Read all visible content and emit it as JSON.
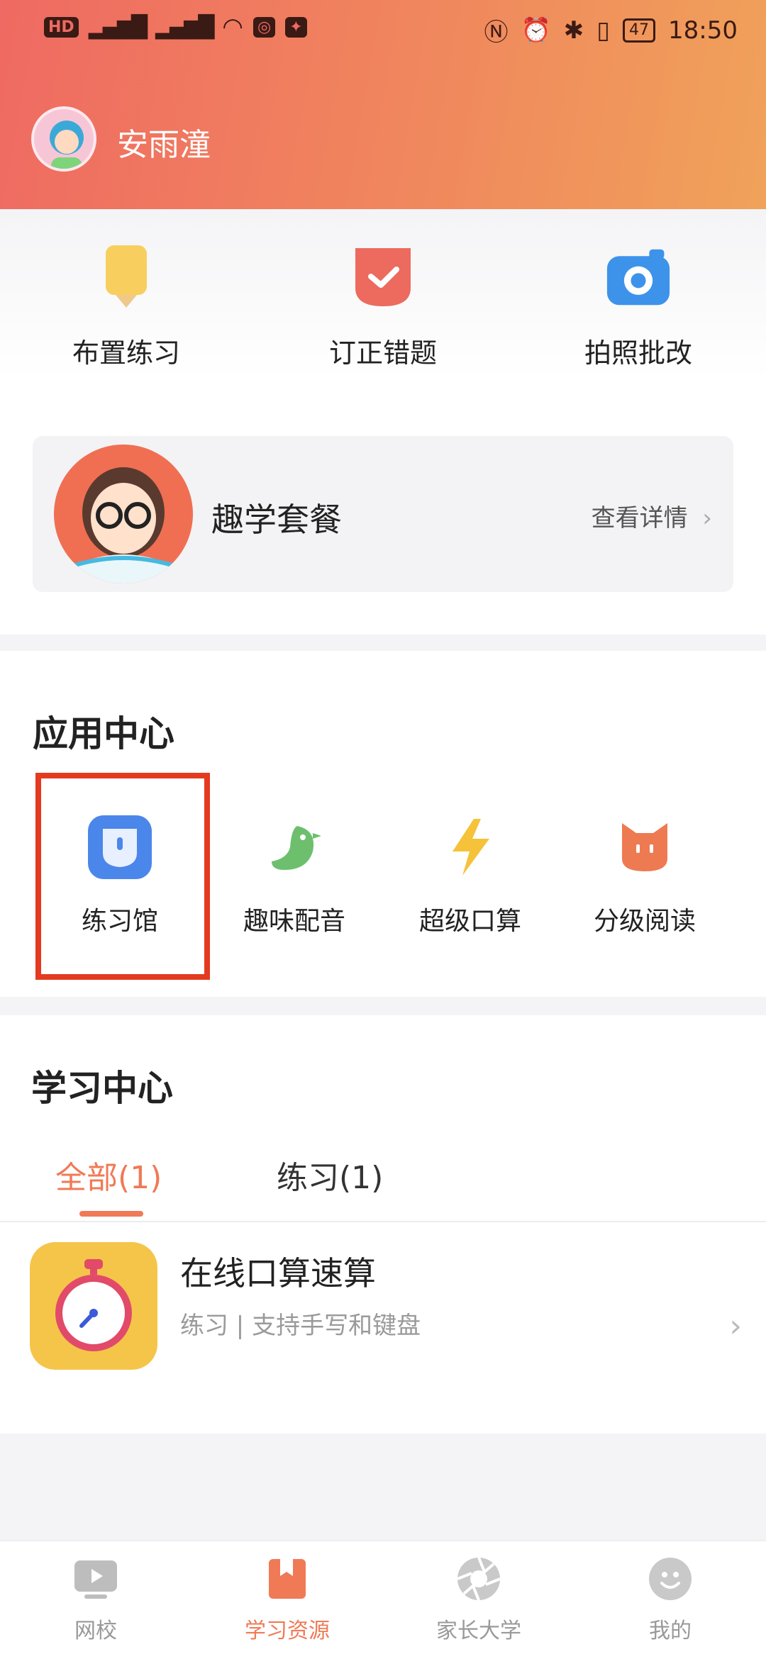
{
  "status_bar": {
    "left_badges": [
      "HD",
      "4G",
      "4G"
    ],
    "time": "18:50",
    "battery": "47"
  },
  "profile": {
    "name": "安雨潼"
  },
  "quick_actions": [
    {
      "label": "布置练习",
      "icon": "pencil-icon",
      "color": "#f8cf5e"
    },
    {
      "label": "订正错题",
      "icon": "check-shield-icon",
      "color": "#ec6a5e"
    },
    {
      "label": "拍照批改",
      "icon": "camera-icon",
      "color": "#3d93ea"
    }
  ],
  "package": {
    "title": "趣学套餐",
    "link": "查看详情"
  },
  "app_center": {
    "title": "应用中心",
    "apps": [
      {
        "label": "练习馆",
        "icon": "practice-hall-icon",
        "color": "#4b86ea"
      },
      {
        "label": "趣味配音",
        "icon": "bird-icon",
        "color": "#6dbf6e"
      },
      {
        "label": "超级口算",
        "icon": "lightning-icon",
        "color": "#f5c23a"
      },
      {
        "label": "分级阅读",
        "icon": "cat-icon",
        "color": "#ee7a52"
      }
    ]
  },
  "learning_center": {
    "title": "学习中心",
    "tabs": [
      {
        "label": "全部(1)",
        "active": true
      },
      {
        "label": "练习(1)",
        "active": false
      }
    ],
    "items": [
      {
        "title": "在线口算速算",
        "subtitle": "练习 | 支持手写和键盘"
      }
    ]
  },
  "bottom_nav": [
    {
      "label": "网校",
      "icon": "video-play-icon",
      "active": false
    },
    {
      "label": "学习资源",
      "icon": "bookmark-book-icon",
      "active": true
    },
    {
      "label": "家长大学",
      "icon": "aperture-icon",
      "active": false
    },
    {
      "label": "我的",
      "icon": "smiley-icon",
      "active": false
    }
  ],
  "colors": {
    "accent": "#f07a55",
    "highlight_border": "#e43a20"
  }
}
